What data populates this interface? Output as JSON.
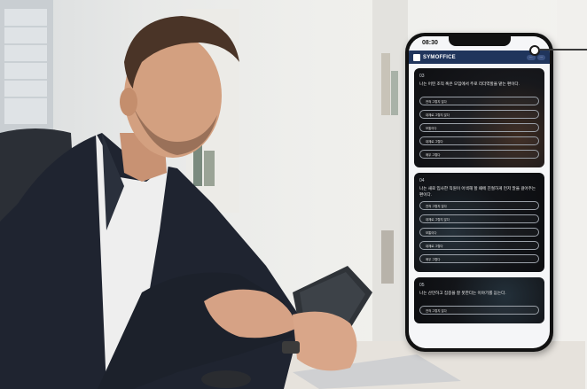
{
  "photo": {
    "description_icon": "man-with-phone-photo"
  },
  "phone": {
    "status_time": "08:30",
    "app_name": "SYMOFFICE",
    "header_buttons": [
      "···",
      "···"
    ],
    "questions": [
      {
        "number": "03",
        "text": "나는 어떤 조직 혹은 모임에서 주로 리더역할을 맡는 편이다.",
        "options": [
          "전혀 그렇지 않다",
          "대체로 그렇지 않다",
          "보통이다",
          "대체로 그렇다",
          "매우 그렇다"
        ]
      },
      {
        "number": "04",
        "text": "나는 새로 입사한 직원이 어색해 할 때에 친절하게 먼저 말을 걸어주는 편이다.",
        "options": [
          "전혀 그렇지 않다",
          "대체로 그렇지 않다",
          "보통이다",
          "대체로 그렇다",
          "매우 그렇다"
        ]
      },
      {
        "number": "05",
        "text": "나는 산만하고 집중을 잘 못한다는 이야기를 듣는다.",
        "options": [
          "전혀 그렇지 않다"
        ]
      }
    ]
  },
  "colors": {
    "appbar": "#20355c",
    "card_dark": "#111318",
    "suit": "#1f2430"
  }
}
